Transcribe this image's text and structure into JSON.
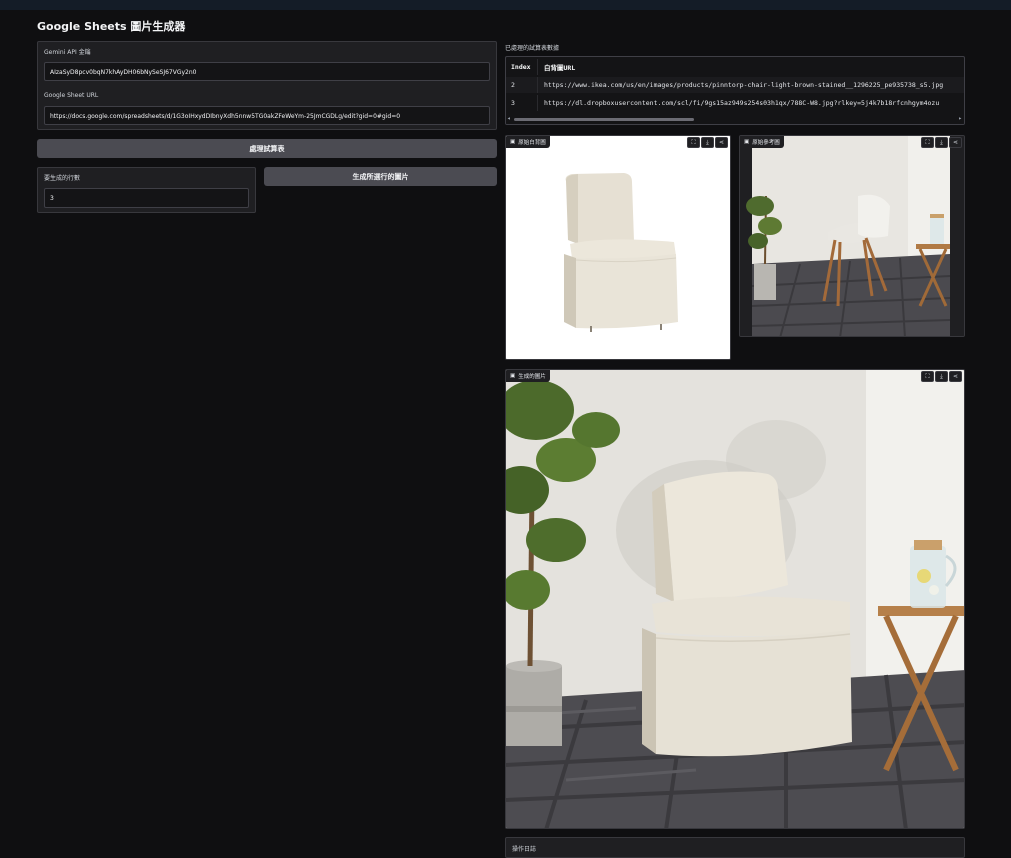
{
  "app": {
    "title": "Google Sheets 圖片生成器"
  },
  "settings": {
    "api_key_label": "Gemini API 金鑰",
    "api_key_value": "AIzaSyD8pcv0bqN7khAyDH06bNySeSJ67VGy2n0",
    "sheet_url_label": "Google Sheet URL",
    "sheet_url_value": "https://docs.google.com/spreadsheets/d/1G3oIHxydDIbnyXdh5nnw5TG0akZFeWeYm-25JmCGDLg/edit?gid=0#gid=0"
  },
  "actions": {
    "process_label": "處理試算表",
    "generate_label": "生成所選行的圖片"
  },
  "rows": {
    "label": "要生成的行數",
    "value": "3"
  },
  "table": {
    "section_label": "已處理的試算表數據",
    "headers": {
      "index": "Index",
      "url": "白背圖URL"
    },
    "rows": [
      {
        "index": "2",
        "url": "https://www.ikea.com/us/en/images/products/pinntorp-chair-light-brown-stained__1296225_pe935738_s5.jpg"
      },
      {
        "index": "3",
        "url": "https://dl.dropboxusercontent.com/scl/fi/9gs15az949s254s03h1qx/788C-W8.jpg?rlkey=5j4k7b18rfcnhgym4ozu"
      }
    ]
  },
  "images": {
    "original_white": "原始白背圖",
    "original_reference": "原始參考圖",
    "generated": "生成的圖片"
  },
  "log": {
    "label": "操作日誌"
  },
  "icons": [
    "image-icon",
    "fullscreen-icon",
    "download-icon",
    "share-icon"
  ],
  "colors": {
    "background": "#0f0f11",
    "panel": "#1f1f22",
    "button": "#4b4b52",
    "topbar": "#141c27"
  }
}
